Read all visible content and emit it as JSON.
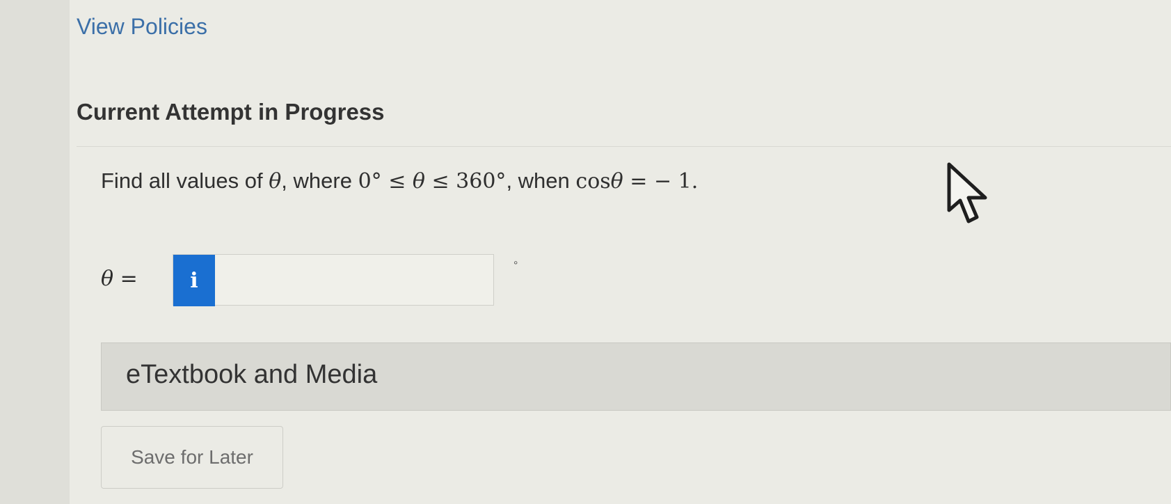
{
  "header": {
    "policies_link": "View Policies",
    "attempt_heading": "Current Attempt in Progress"
  },
  "question": {
    "prefix": "Find all values of ",
    "var": "θ",
    "where_text": ", where ",
    "lower": "0°",
    "leq1": " ≤ ",
    "var2": "θ",
    "leq2": " ≤ ",
    "upper": "360°",
    "when_text": ", when ",
    "func": "cos",
    "var3": "θ",
    "equals": " = ",
    "rhs": "− 1."
  },
  "answer": {
    "label": "θ =",
    "info_glyph": "i",
    "value": "",
    "placeholder": "",
    "unit": "°"
  },
  "resources": {
    "etextbook_label": "eTextbook and Media"
  },
  "actions": {
    "save_label": "Save for Later"
  },
  "icons": {
    "pointer": "mouse-pointer-icon",
    "info": "info-icon"
  },
  "colors": {
    "link": "#3b6fa8",
    "info_button": "#1a6fd1",
    "background": "#ebebe5"
  }
}
